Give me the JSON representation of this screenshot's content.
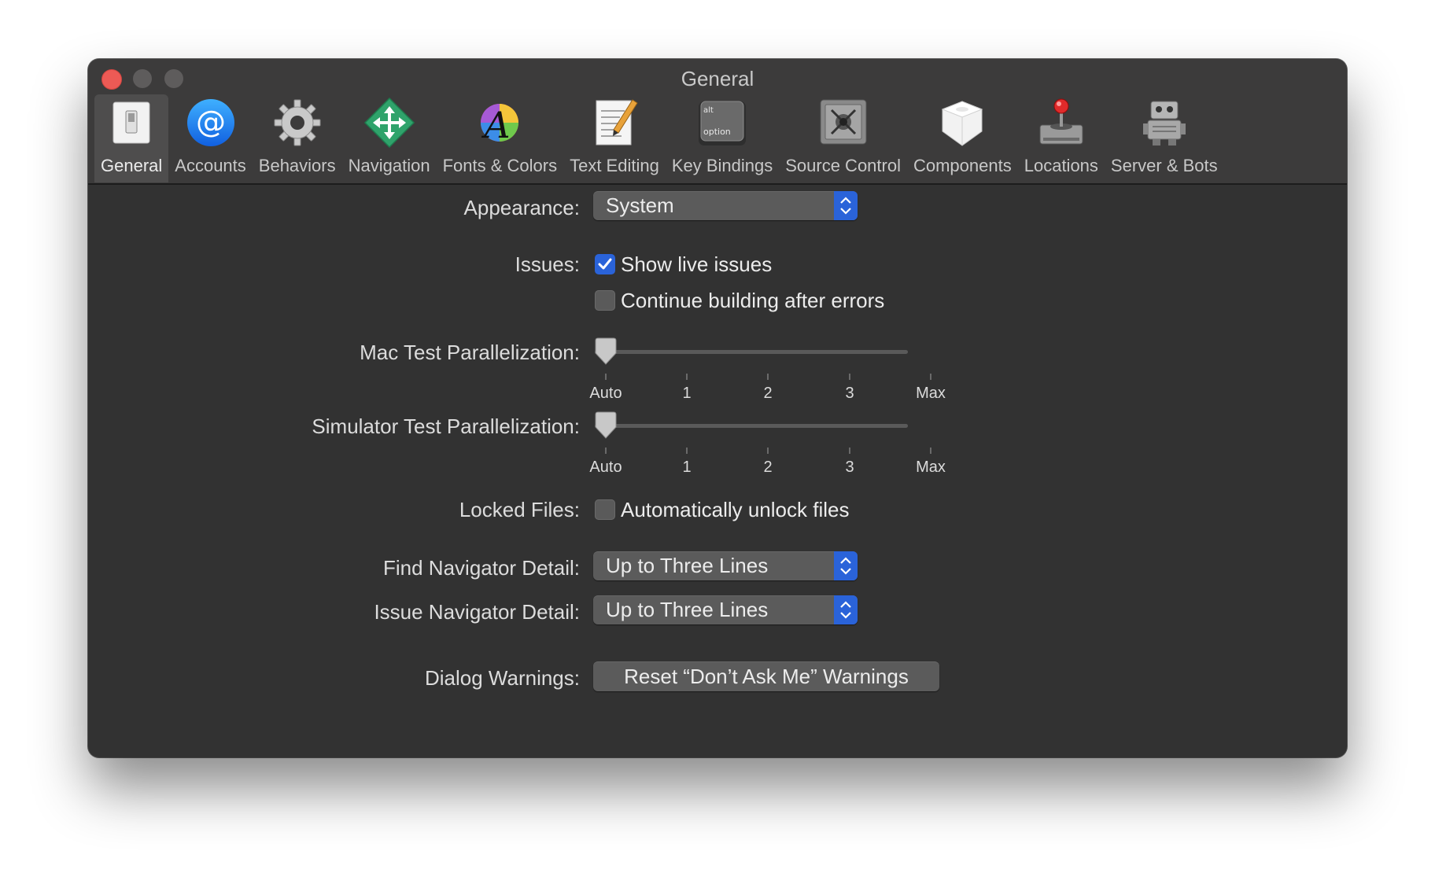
{
  "window": {
    "title": "General"
  },
  "toolbar": {
    "items": [
      {
        "label": "General",
        "icon": "switch-icon",
        "selected": true
      },
      {
        "label": "Accounts",
        "icon": "at-sign-icon"
      },
      {
        "label": "Behaviors",
        "icon": "gear-icon"
      },
      {
        "label": "Navigation",
        "icon": "navigation-arrows-icon"
      },
      {
        "label": "Fonts & Colors",
        "icon": "color-wheel-font-icon"
      },
      {
        "label": "Text Editing",
        "icon": "pencil-document-icon"
      },
      {
        "label": "Key Bindings",
        "icon": "option-key-icon"
      },
      {
        "label": "Source Control",
        "icon": "vault-icon"
      },
      {
        "label": "Components",
        "icon": "component-box-icon"
      },
      {
        "label": "Locations",
        "icon": "joystick-drive-icon"
      },
      {
        "label": "Server & Bots",
        "icon": "robot-icon"
      }
    ]
  },
  "keycap": {
    "top": "alt",
    "bottom": "option"
  },
  "settings": {
    "appearance": {
      "label": "Appearance:",
      "value": "System"
    },
    "issues": {
      "label": "Issues:",
      "show_live": {
        "label": "Show live issues",
        "checked": true
      },
      "continue_building": {
        "label": "Continue building after errors",
        "checked": false
      }
    },
    "mac_parallel": {
      "label": "Mac Test Parallelization:",
      "ticks": [
        "Auto",
        "1",
        "2",
        "3",
        "Max"
      ],
      "value": "Auto"
    },
    "sim_parallel": {
      "label": "Simulator Test Parallelization:",
      "ticks": [
        "Auto",
        "1",
        "2",
        "3",
        "Max"
      ],
      "value": "Auto"
    },
    "locked_files": {
      "label": "Locked Files:",
      "auto_unlock": {
        "label": "Automatically unlock files",
        "checked": false
      }
    },
    "find_nav": {
      "label": "Find Navigator Detail:",
      "value": "Up to Three Lines"
    },
    "issue_nav": {
      "label": "Issue Navigator Detail:",
      "value": "Up to Three Lines"
    },
    "dialog_warnings": {
      "label": "Dialog Warnings:",
      "button": "Reset “Don’t Ask Me” Warnings"
    }
  },
  "colors": {
    "accent": "#2a63d9",
    "close": "#ed5a55",
    "window_bg": "#323232"
  }
}
